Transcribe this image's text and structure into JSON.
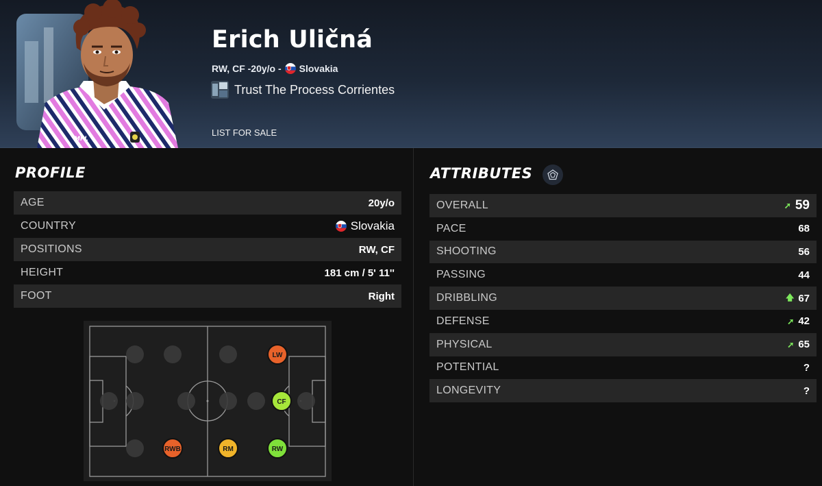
{
  "player": {
    "name": "Erich Uličná",
    "positions_age": "RW, CF -20y/o -",
    "country": "Slovakia",
    "club": "Trust The Process Corrientes",
    "list_for_sale": "LIST FOR SALE"
  },
  "profile": {
    "title": "PROFILE",
    "rows": [
      {
        "label": "AGE",
        "value": "20y/o"
      },
      {
        "label": "COUNTRY",
        "value": "Slovakia"
      },
      {
        "label": "POSITIONS",
        "value": "RW, CF"
      },
      {
        "label": "HEIGHT",
        "value": "181 cm / 5' 11''"
      },
      {
        "label": "FOOT",
        "value": "Right"
      }
    ]
  },
  "attributes": {
    "title": "ATTRIBUTES",
    "rows": [
      {
        "label": "OVERALL",
        "value": "59",
        "trend": "up-right"
      },
      {
        "label": "PACE",
        "value": "68",
        "trend": ""
      },
      {
        "label": "SHOOTING",
        "value": "56",
        "trend": ""
      },
      {
        "label": "PASSING",
        "value": "44",
        "trend": ""
      },
      {
        "label": "DRIBBLING",
        "value": "67",
        "trend": "up"
      },
      {
        "label": "DEFENSE",
        "value": "42",
        "trend": "up-right"
      },
      {
        "label": "PHYSICAL",
        "value": "65",
        "trend": "up-right"
      },
      {
        "label": "POTENTIAL",
        "value": "?",
        "trend": ""
      },
      {
        "label": "LONGEVITY",
        "value": "?",
        "trend": ""
      }
    ]
  },
  "pitch_positions": [
    {
      "label": "LW",
      "color": "#e8622a"
    },
    {
      "label": "CF",
      "color": "#a6e63a"
    },
    {
      "label": "RWB",
      "color": "#e8622a"
    },
    {
      "label": "RM",
      "color": "#f0b42a"
    },
    {
      "label": "RW",
      "color": "#7fe03a"
    }
  ],
  "colors": {
    "trend_up": "#7de85c",
    "row_shade": "#272727",
    "background": "#101010"
  },
  "icons": {
    "attributes_badge": "pentagon-radar-icon",
    "trend_up": "arrow-up-icon",
    "trend_up_right": "arrow-up-right-icon"
  }
}
